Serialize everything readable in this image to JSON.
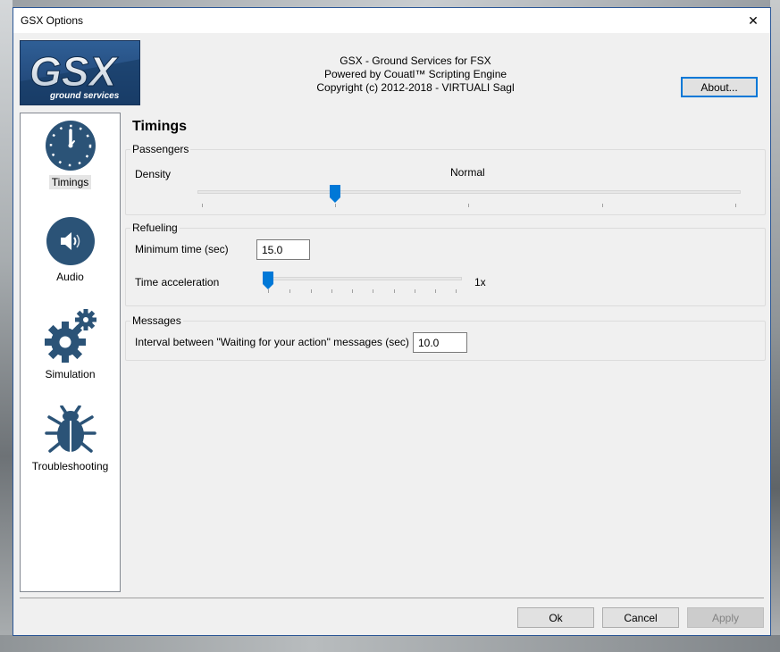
{
  "window": {
    "title": "GSX Options",
    "close_glyph": "✕"
  },
  "logo": {
    "brand": "GSX",
    "tagline": "ground services"
  },
  "header": {
    "line1": "GSX - Ground Services for FSX",
    "line2": "Powered by Couatl™ Scripting Engine",
    "line3": "Copyright (c) 2012-2018 - VIRTUALI Sagl",
    "about_label": "About..."
  },
  "sidebar": {
    "items": [
      {
        "label": "Timings",
        "icon": "clock-icon",
        "active": true
      },
      {
        "label": "Audio",
        "icon": "speaker-icon",
        "active": false
      },
      {
        "label": "Simulation",
        "icon": "gears-icon",
        "active": false
      },
      {
        "label": "Troubleshooting",
        "icon": "bug-icon",
        "active": false
      }
    ]
  },
  "content": {
    "title": "Timings",
    "passengers": {
      "caption": "Passengers",
      "density_label": "Density",
      "density_value": "Normal",
      "density_level": 0.25
    },
    "refueling": {
      "caption": "Refueling",
      "min_time_label": "Minimum time (sec)",
      "min_time_value": "15.0",
      "time_accel_label": "Time acceleration",
      "time_accel_value": "1x",
      "time_accel_level": 0.0
    },
    "messages": {
      "caption": "Messages",
      "interval_label": "Interval between \"Waiting for your action\" messages (sec)",
      "interval_value": "10.0"
    }
  },
  "footer": {
    "ok_label": "Ok",
    "cancel_label": "Cancel",
    "apply_label": "Apply"
  },
  "colors": {
    "icon_blue": "#2b5377",
    "accent": "#0078d7"
  }
}
